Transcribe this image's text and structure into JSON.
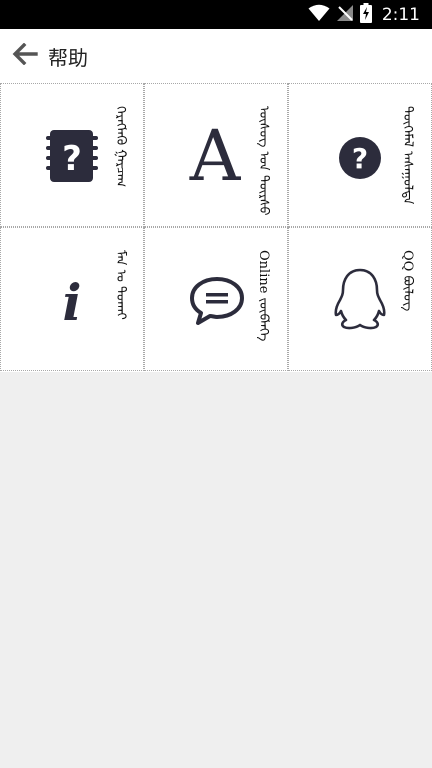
{
  "status_bar": {
    "time": "2:11",
    "icons": [
      "wifi-icon",
      "no-signal-icon",
      "battery-charging-icon"
    ]
  },
  "app_bar": {
    "back_icon": "arrow-left-icon",
    "title": "帮助"
  },
  "grid": {
    "items": [
      {
        "icon": "notebook-question-icon",
        "label": "ᠬᠡᠷᠡᠭᠯᠡᠬᠦ ᠭᠠᠷᠴᠠᠭ"
      },
      {
        "icon": "font-letter-a-icon",
        "label": "ᠦᠰᠦᠭ ᠤᠨ ᠳᠦᠷᠰᠦ ᠰᠣᠩᠭᠣᠬᠤ"
      },
      {
        "icon": "help-circle-icon",
        "label": "ᠲᠦᠭᠡᠮᠡᠯ ᠠᠰᠠᠭᠤᠯᠲᠠ"
      },
      {
        "icon": "info-icon",
        "label": "ᠮᠠᠨ ᠤ ᠲᠤᠬᠠᠢ"
      },
      {
        "icon": "chat-bubble-icon",
        "label": "Online ᠵᠥᠪᠯᠡᠭᠡ"
      },
      {
        "icon": "qq-penguin-icon",
        "label": "QQ ᠪᠦᠯᠦᠭ"
      }
    ]
  },
  "colors": {
    "status_bar_bg": "#000000",
    "app_bar_bg": "#ffffff",
    "icon_dark": "#2c2c3c",
    "page_bg": "#efefef"
  }
}
